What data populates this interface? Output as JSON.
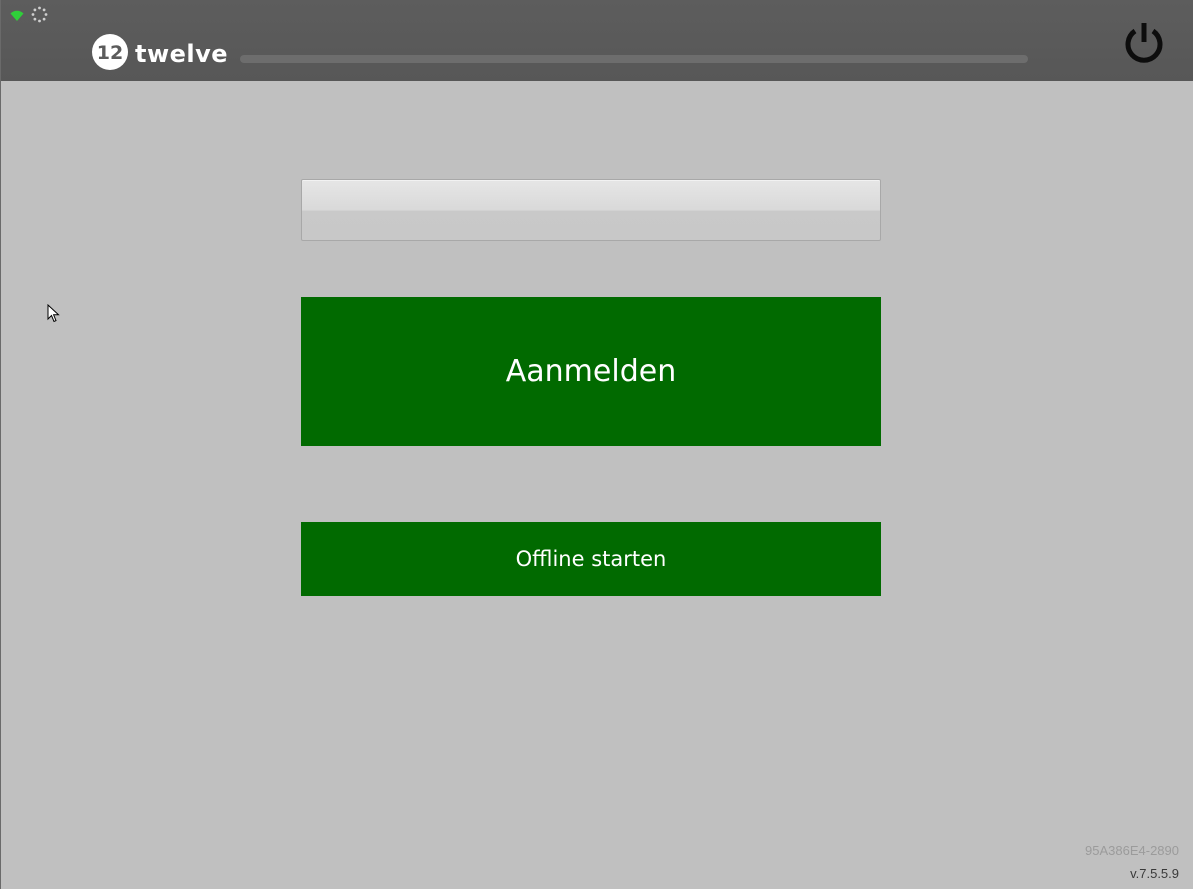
{
  "header": {
    "logo_text": "twelve",
    "logo_mark_text": "12",
    "progress_value": 0,
    "icons": {
      "wifi": "wifi-icon",
      "spinner": "loading-spinner-icon",
      "power": "power-icon"
    }
  },
  "login": {
    "input_value": "",
    "input_placeholder": "",
    "login_label": "Aanmelden",
    "offline_label": "Offline starten"
  },
  "footer": {
    "device_id": "95A386E4-2890",
    "version": "v.7.5.5.9"
  },
  "colors": {
    "header_bg": "#5b5b5b",
    "page_bg": "#c0c0c0",
    "button_green": "#016a00",
    "wifi_green": "#2fcf3a"
  }
}
